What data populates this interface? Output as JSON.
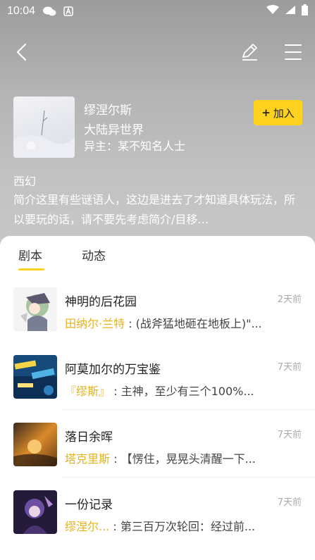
{
  "status_bar": {
    "time": "10:04"
  },
  "header": {
    "author": "缪涅尔斯",
    "title": "大陆异世界",
    "owner": "异主：某不知名人士",
    "join_label": "加入",
    "join_plus": "+"
  },
  "genre": "西幻",
  "description": "简介这里有些谜语人，这边是进去了才知道具体玩法，所以要玩的话，请不要先考虑简介/目移…",
  "tabs": [
    {
      "label": "剧本"
    },
    {
      "label": "动态"
    }
  ],
  "scripts": [
    {
      "name": "神明的后花园",
      "time": "2天前",
      "speaker": "田纳尔·兰特",
      "text": "(战斧猛地砸在地板上)\"..."
    },
    {
      "name": "阿莫加尔的万宝鉴",
      "time": "7天前",
      "speaker": "『缪斯』",
      "text": "主神，至少有三个100%..."
    },
    {
      "name": "落日余晖",
      "time": "7天前",
      "speaker": "塔克里斯",
      "text": "【愣住，晃晃头清醒一下..."
    },
    {
      "name": "一份记录",
      "time": "7天前",
      "speaker": "缪涅尔...",
      "text": "第三百万次轮回：经过前..."
    }
  ],
  "colors": {
    "accent": "#ffd21f",
    "speaker": "#e7b21c"
  },
  "icons": [
    "back-arrow-icon",
    "edit-icon",
    "menu-icon",
    "chat-icon",
    "notification-a-icon",
    "wifi-icon",
    "signal-icon",
    "battery-icon"
  ]
}
